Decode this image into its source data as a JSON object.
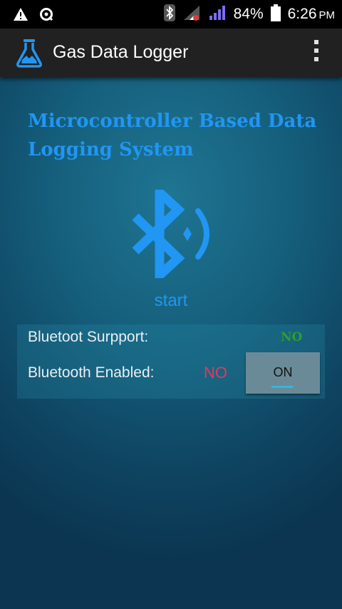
{
  "status_bar": {
    "battery_percent": "84%",
    "time": "6:26",
    "ampm": "PM",
    "icons": [
      "warning-icon",
      "sync-icon",
      "bluetooth-icon",
      "signal-icon",
      "signal-icon",
      "battery-icon"
    ]
  },
  "action_bar": {
    "title": "Gas Data Logger",
    "icon": "flask-icon"
  },
  "main": {
    "heading": "Microcontroller Based Data Logging System",
    "start_label": "start",
    "support_label": "Bluetoot Surpport:",
    "support_value": "NO",
    "enabled_label": "Bluetooth Enabled:",
    "enabled_value": "NO",
    "toggle_label": "ON"
  },
  "colors": {
    "accent": "#2196f3",
    "action_bar": "#212121",
    "no_green": "#2e9e2e",
    "no_red": "#e8375a",
    "toggle_indicator": "#33b5e5"
  }
}
